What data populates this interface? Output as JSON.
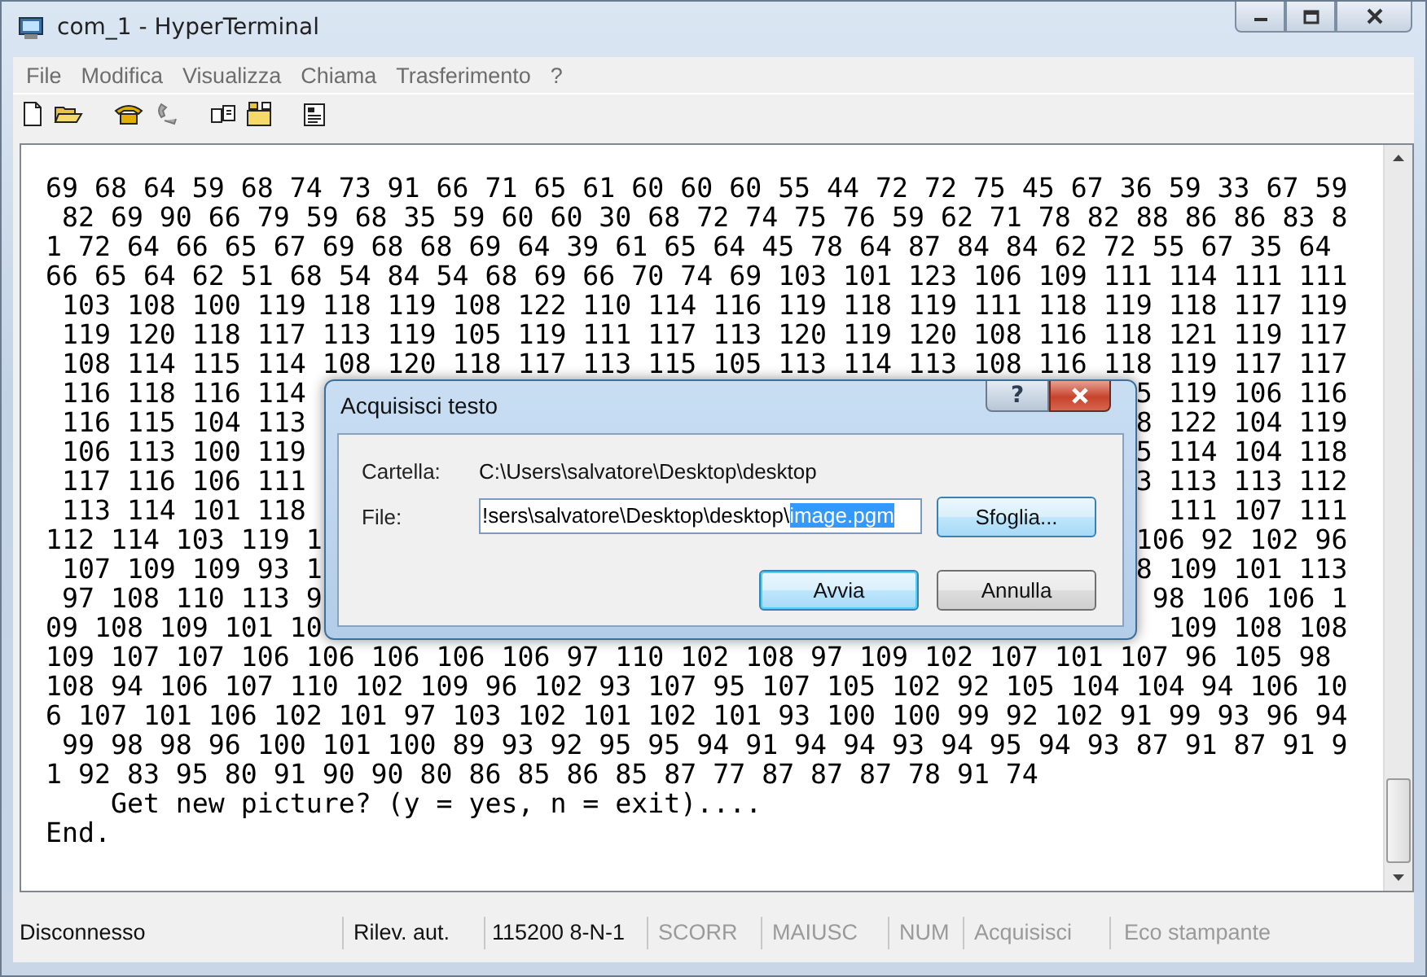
{
  "window": {
    "title": "com_1 - HyperTerminal"
  },
  "menu": [
    "File",
    "Modifica",
    "Visualizza",
    "Chiama",
    "Trasferimento",
    "?"
  ],
  "terminal": {
    "lines": [
      {
        "kind": "full",
        "text": "69 68 64 59 68 74 73 91 66 71 65 61 60 60 60 55 44 72 72 75 45 67 36 59 33 67 59"
      },
      {
        "kind": "full",
        "text": " 82 69 90 66 79 59 68 35 59 60 60 30 68 72 74 75 76 59 62 71 78 82 88 86 86 83 8"
      },
      {
        "kind": "full",
        "text": "1 72 64 66 65 67 69 68 68 69 64 39 61 65 64 45 78 64 87 84 84 62 72 55 67 35 64"
      },
      {
        "kind": "full",
        "text": "66 65 64 62 51 68 54 84 54 68 69 66 70 74 69 103 101 123 106 109 111 114 111 111"
      },
      {
        "kind": "full",
        "text": " 103 108 100 119 118 119 108 122 110 114 116 119 118 119 111 118 119 118 117 119"
      },
      {
        "kind": "full",
        "text": " 119 120 118 117 113 119 105 119 111 117 113 120 119 120 108 116 118 121 119 117"
      },
      {
        "kind": "full",
        "text": " 108 114 115 114 108 120 118 117 113 115 105 113 114 113 108 116 118 119 117 117"
      },
      {
        "kind": "split",
        "left": " 116 118 116 114",
        "right": "5 119 106 116"
      },
      {
        "kind": "split",
        "left": " 116 115 104 113",
        "right": "8 122 104 119"
      },
      {
        "kind": "split",
        "left": " 106 113 100 119",
        "right": "5 114 104 118"
      },
      {
        "kind": "split",
        "left": " 117 116 106 111",
        "right": "3 113 113 112"
      },
      {
        "kind": "split",
        "left": " 113 114 101 118",
        "right": "111 107 111"
      },
      {
        "kind": "split",
        "left": "112 114 103 119 1",
        "right": "106 92 102 96"
      },
      {
        "kind": "split",
        "left": " 107 109 109 93 1",
        "right": "8 109 101 113"
      },
      {
        "kind": "split",
        "left": " 97 108 110 113 9",
        "right": "98 106 106 1"
      },
      {
        "kind": "split",
        "left": "09 108 109 101 10",
        "right": "109 108 108"
      },
      {
        "kind": "full",
        "text": "109 107 107 106 106 106 106 106 97 110 102 108 97 109 102 107 101 107 96 105 98"
      },
      {
        "kind": "full",
        "text": "108 94 106 107 110 102 109 96 102 93 107 95 107 105 102 92 105 104 104 94 106 10"
      },
      {
        "kind": "full",
        "text": "6 107 101 106 102 101 97 103 102 101 102 101 93 100 100 99 92 102 91 99 93 96 94"
      },
      {
        "kind": "full",
        "text": " 99 98 98 96 100 101 100 89 93 92 95 95 94 91 94 94 93 94 95 94 93 87 91 87 91 9"
      },
      {
        "kind": "full",
        "text": "1 92 83 95 80 91 90 90 80 86 85 86 85 87 77 87 87 87 78 91 74"
      },
      {
        "kind": "full",
        "text": "    Get new picture? (y = yes, n = exit)...."
      },
      {
        "kind": "full",
        "text": "End."
      }
    ]
  },
  "dialog": {
    "title": "Acquisisci testo",
    "help_button": "?",
    "folder_label": "Cartella:",
    "folder": "C:\\Users\\salvatore\\Desktop\\desktop",
    "file_label": "File:",
    "file_value": "!sers\\salvatore\\Desktop\\desktop\\",
    "file_selected": "image.pgm",
    "browse_button": "Sfoglia...",
    "buttons": [
      {
        "label": "Avvia",
        "default": true
      },
      {
        "label": "Annulla",
        "default": false
      }
    ]
  },
  "status_bar": [
    {
      "text": "Disconnesso",
      "active": true
    },
    {
      "text": "Rilev. aut.",
      "active": true
    },
    {
      "text": "115200 8-N-1",
      "active": true
    },
    {
      "text": "SCORR",
      "active": false
    },
    {
      "text": "MAIUSC",
      "active": false
    },
    {
      "text": "NUM",
      "active": false
    },
    {
      "text": "Acquisisci",
      "active": false
    },
    {
      "text": "Eco stampante",
      "active": false
    }
  ]
}
